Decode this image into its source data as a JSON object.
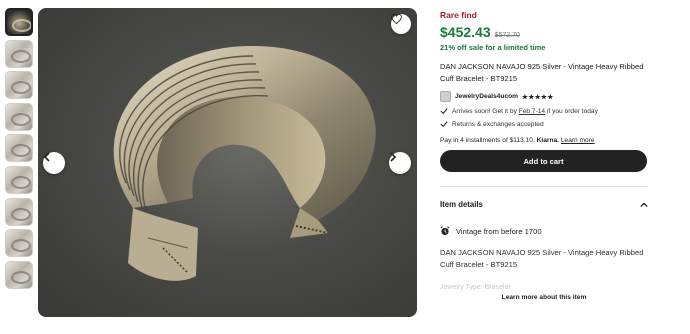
{
  "thumbnails": [
    {
      "name": "thumbnail-1",
      "selected": true
    },
    {
      "name": "thumbnail-2",
      "selected": false
    },
    {
      "name": "thumbnail-3",
      "selected": false
    },
    {
      "name": "thumbnail-4",
      "selected": false
    },
    {
      "name": "thumbnail-5",
      "selected": false
    },
    {
      "name": "thumbnail-6",
      "selected": false
    },
    {
      "name": "thumbnail-7",
      "selected": false
    },
    {
      "name": "thumbnail-8",
      "selected": false
    },
    {
      "name": "thumbnail-9",
      "selected": false
    }
  ],
  "image": {
    "favorite_icon": "heart-icon",
    "prev_icon": "chevron-left-icon",
    "next_icon": "chevron-right-icon"
  },
  "listing": {
    "badge": "Rare find",
    "price": "$452.43",
    "original_price": "$572.70",
    "sale_text": "21% off sale for a limited time",
    "title": "DAN JACKSON NAVAJO 925 Silver - Vintage Heavy Ribbed Cuff Bracelet - BT9215",
    "shop_name": "JewelryDeals4ucom",
    "rating_stars": "★★★★★",
    "arrival_prefix": "Arrives soon! Get it by ",
    "arrival_date": "Feb 7-14",
    "arrival_suffix": " if you order today",
    "returns": "Returns & exchanges accepted",
    "install_prefix": "Pay in 4 installments of $113.10. ",
    "install_brand": "Klarna.",
    "install_link": "Learn more",
    "cart_button": "Add to cart"
  },
  "details": {
    "heading": "Item details",
    "vintage": "Vintage from before 1700",
    "description": "DAN JACKSON NAVAJO 925 Silver - Vintage Heavy Ribbed Cuff Bracelet - BT9215",
    "faded_line": "Jewelry Type: Bracelet",
    "learn_more": "Learn more about this item"
  },
  "colors": {
    "price_green": "#1a7a3c",
    "rare_red": "#a61a2e",
    "button_dark": "#222222"
  }
}
